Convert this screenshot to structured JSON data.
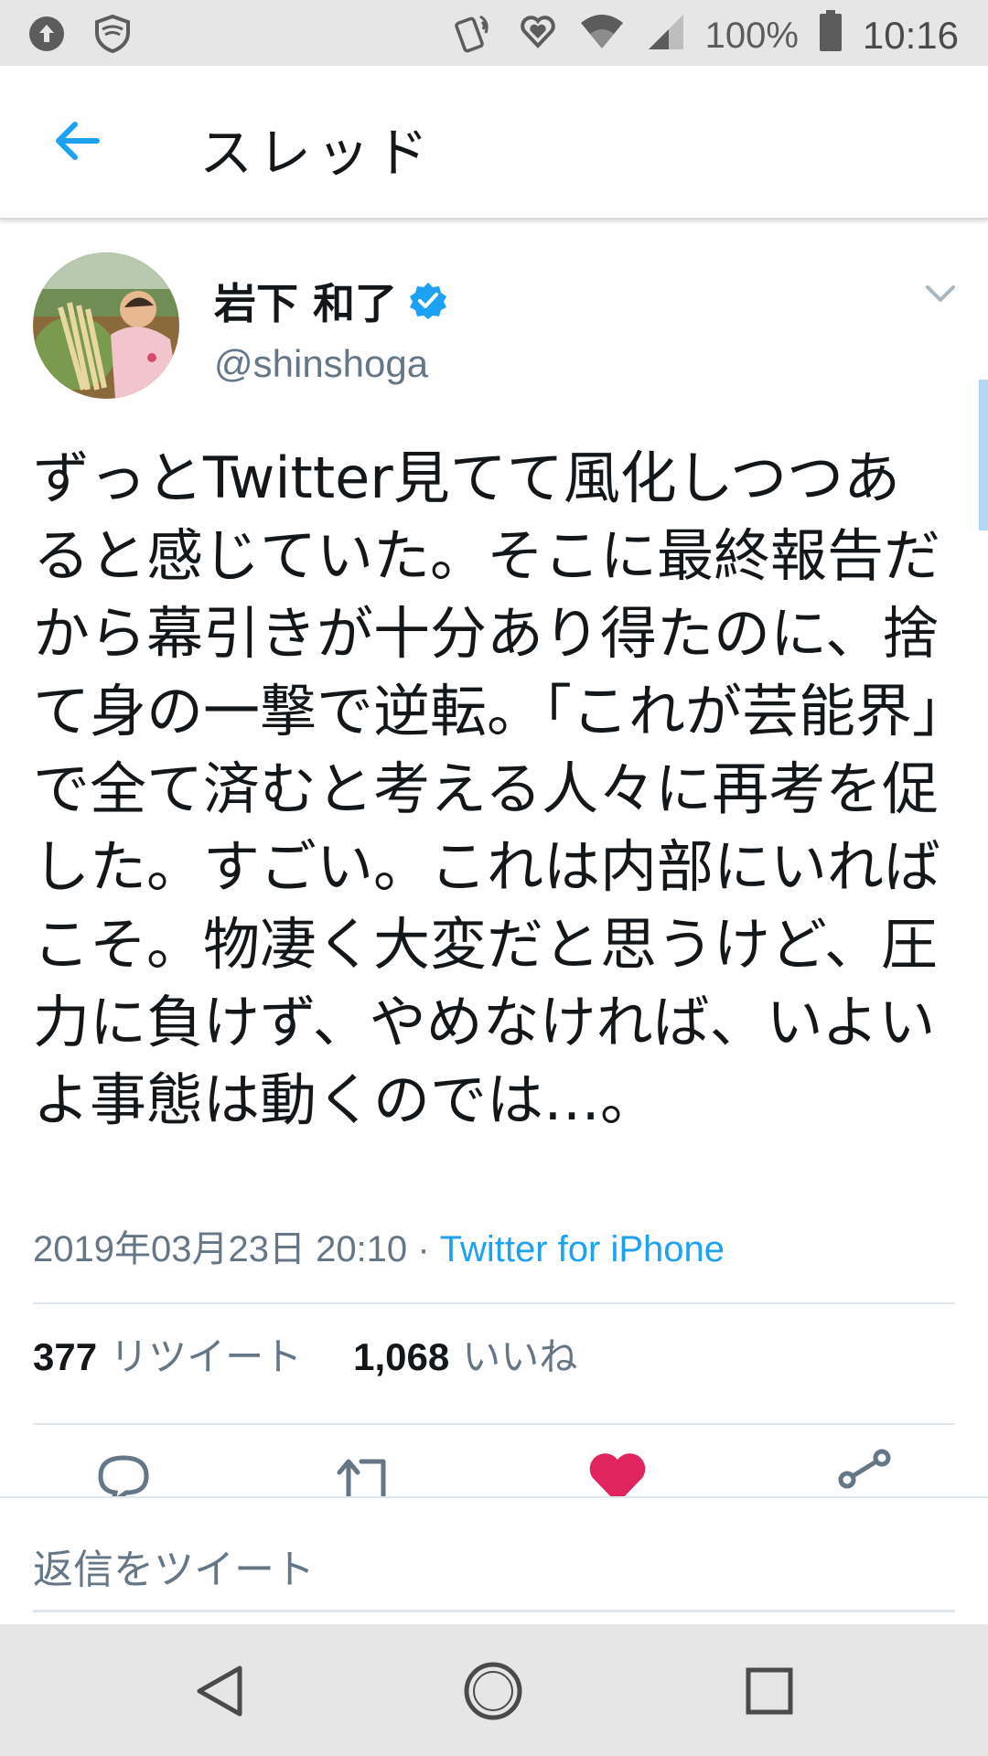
{
  "status_bar": {
    "battery": "100%",
    "time": "10:16"
  },
  "header": {
    "title": "スレッド"
  },
  "tweet": {
    "author_name": "岩下 和了",
    "handle": "@shinshoga",
    "text": "ずっとTwitter見てて風化しつつあると感じていた。そこに最終報告だから幕引きが十分あり得たのに、捨て身の一撃で逆転。「これが芸能界」で全て済むと考える人々に再考を促した。すごい。これは内部にいればこそ。物凄く大変だと思うけど、圧力に負けず、やめなければ、いよいよ事態は動くのでは…。",
    "timestamp": "2019年03月23日 20:10",
    "separator": "·",
    "source": "Twitter for iPhone",
    "retweet_count": "377",
    "retweet_label": "リツイート",
    "like_count": "1,068",
    "like_label": "いいね"
  },
  "reply": {
    "placeholder": "返信をツイート"
  },
  "colors": {
    "accent": "#1da1f2",
    "like": "#e0245e",
    "secondary_text": "#657786"
  }
}
